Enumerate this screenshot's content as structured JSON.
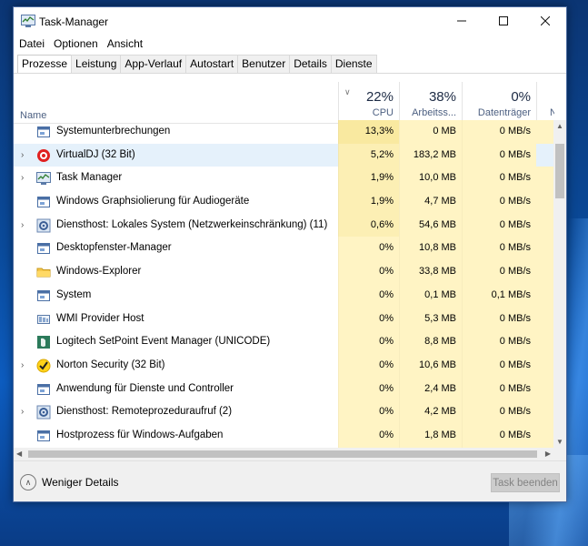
{
  "window": {
    "title": "Task-Manager",
    "minimize_icon": "minimize-icon",
    "maximize_icon": "maximize-icon",
    "close_icon": "close-icon"
  },
  "menu": [
    "Datei",
    "Optionen",
    "Ansicht"
  ],
  "tabs": [
    {
      "label": "Prozesse",
      "active": true
    },
    {
      "label": "Leistung",
      "active": false
    },
    {
      "label": "App-Verlauf",
      "active": false
    },
    {
      "label": "Autostart",
      "active": false
    },
    {
      "label": "Benutzer",
      "active": false
    },
    {
      "label": "Details",
      "active": false
    },
    {
      "label": "Dienste",
      "active": false
    }
  ],
  "columns": {
    "name": "Name",
    "cpu": {
      "percent": "22%",
      "label": "CPU"
    },
    "memory": {
      "percent": "38%",
      "label": "Arbeitss..."
    },
    "disk": {
      "percent": "0%",
      "label": "Datenträger"
    },
    "network": {
      "label": "Netz"
    }
  },
  "colors": {
    "heat_high": "#f9e9a0",
    "heat_mid": "#fcefb4",
    "heat_low": "#fff4c4",
    "selected": "#e5f1fb"
  },
  "processes": [
    {
      "name": "Systemunterbrechungen",
      "icon": "system-process-icon",
      "expandable": false,
      "cpu": "13,3%",
      "memory": "0 MB",
      "disk": "0 MB/s",
      "heat": "high"
    },
    {
      "name": "VirtualDJ (32 Bit)",
      "icon": "virtualdj-icon",
      "expandable": true,
      "cpu": "5,2%",
      "memory": "183,2 MB",
      "disk": "0 MB/s",
      "heat": "mid",
      "selected": true
    },
    {
      "name": "Task Manager",
      "icon": "task-manager-icon",
      "expandable": true,
      "cpu": "1,9%",
      "memory": "10,0 MB",
      "disk": "0 MB/s",
      "heat": "mid"
    },
    {
      "name": "Windows Graphsiolierung für Audiogeräte",
      "icon": "system-process-icon",
      "expandable": false,
      "cpu": "1,9%",
      "memory": "4,7 MB",
      "disk": "0 MB/s",
      "heat": "mid"
    },
    {
      "name": "Diensthost: Lokales System (Netzwerkeinschränkung) (11)",
      "icon": "gear-icon",
      "expandable": true,
      "cpu": "0,6%",
      "memory": "54,6 MB",
      "disk": "0 MB/s",
      "heat": "mid"
    },
    {
      "name": "Desktopfenster-Manager",
      "icon": "system-process-icon",
      "expandable": false,
      "cpu": "0%",
      "memory": "10,8 MB",
      "disk": "0 MB/s",
      "heat": "low"
    },
    {
      "name": "Windows-Explorer",
      "icon": "folder-icon",
      "expandable": false,
      "cpu": "0%",
      "memory": "33,8 MB",
      "disk": "0 MB/s",
      "heat": "low"
    },
    {
      "name": "System",
      "icon": "system-process-icon",
      "expandable": false,
      "cpu": "0%",
      "memory": "0,1 MB",
      "disk": "0,1 MB/s",
      "heat": "low"
    },
    {
      "name": "WMI Provider Host",
      "icon": "wmi-icon",
      "expandable": false,
      "cpu": "0%",
      "memory": "5,3 MB",
      "disk": "0 MB/s",
      "heat": "low"
    },
    {
      "name": "Logitech SetPoint Event Manager (UNICODE)",
      "icon": "logitech-icon",
      "expandable": false,
      "cpu": "0%",
      "memory": "8,8 MB",
      "disk": "0 MB/s",
      "heat": "low"
    },
    {
      "name": "Norton Security (32 Bit)",
      "icon": "norton-icon",
      "expandable": true,
      "cpu": "0%",
      "memory": "10,6 MB",
      "disk": "0 MB/s",
      "heat": "low"
    },
    {
      "name": "Anwendung für Dienste und Controller",
      "icon": "system-process-icon",
      "expandable": false,
      "cpu": "0%",
      "memory": "2,4 MB",
      "disk": "0 MB/s",
      "heat": "low"
    },
    {
      "name": "Diensthost: Remoteprozeduraufruf (2)",
      "icon": "gear-icon",
      "expandable": true,
      "cpu": "0%",
      "memory": "4,2 MB",
      "disk": "0 MB/s",
      "heat": "low"
    },
    {
      "name": "Hostprozess für Windows-Aufgaben",
      "icon": "system-process-icon",
      "expandable": false,
      "cpu": "0%",
      "memory": "1,8 MB",
      "disk": "0 MB/s",
      "heat": "low"
    }
  ],
  "footer": {
    "fewer_details": "Weniger Details",
    "end_task": "Task beenden"
  }
}
